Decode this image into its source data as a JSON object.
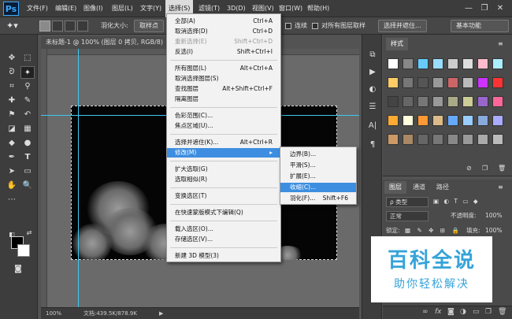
{
  "app": {
    "logo": "Ps"
  },
  "menubar": {
    "items": [
      "文件(F)",
      "编辑(E)",
      "图像(I)",
      "图层(L)",
      "文字(Y)",
      "选择(S)",
      "滤镜(T)",
      "3D(D)",
      "视图(V)",
      "窗口(W)",
      "帮助(H)"
    ]
  },
  "window_controls": {
    "minimize": "—",
    "restore": "❐",
    "close": "✕"
  },
  "options": {
    "feather_label": "羽化大小:",
    "feather_value": "取样点",
    "contiguous_label": "连续",
    "sample_all_label": "对所有图层取样",
    "select_mask_button": "选择并遮住...",
    "workspace_value": "基本功能"
  },
  "document": {
    "tab_title": "未标题-1 @ 100% (图层 0 拷贝, RGB/8) *",
    "zoom": "100%",
    "doc_info": "文档:439.5K/878.9K"
  },
  "select_menu": {
    "items": [
      {
        "label": "全部(A)",
        "shortcut": "Ctrl+A"
      },
      {
        "label": "取消选择(D)",
        "shortcut": "Ctrl+D"
      },
      {
        "label": "重新选择(E)",
        "shortcut": "Shift+Ctrl+D"
      },
      {
        "label": "反选(I)",
        "shortcut": "Shift+Ctrl+I"
      },
      {
        "label": "所有图层(L)",
        "shortcut": "Alt+Ctrl+A"
      },
      {
        "label": "取消选择图层(S)",
        "shortcut": ""
      },
      {
        "label": "查找图层",
        "shortcut": "Alt+Shift+Ctrl+F"
      },
      {
        "label": "隔离图层",
        "shortcut": ""
      },
      {
        "label": "色彩范围(C)...",
        "shortcut": ""
      },
      {
        "label": "焦点区域(U)...",
        "shortcut": ""
      },
      {
        "label": "选择并遮住(K)...",
        "shortcut": "Alt+Ctrl+R"
      },
      {
        "label": "修改(M)",
        "shortcut": "▸"
      },
      {
        "label": "扩大选取(G)",
        "shortcut": ""
      },
      {
        "label": "选取相似(R)",
        "shortcut": ""
      },
      {
        "label": "变换选区(T)",
        "shortcut": ""
      },
      {
        "label": "在快速蒙版模式下编辑(Q)",
        "shortcut": ""
      },
      {
        "label": "载入选区(O)...",
        "shortcut": ""
      },
      {
        "label": "存储选区(V)...",
        "shortcut": ""
      },
      {
        "label": "新建 3D 模型(3)",
        "shortcut": ""
      }
    ]
  },
  "modify_menu": {
    "items": [
      {
        "label": "边界(B)...",
        "shortcut": ""
      },
      {
        "label": "平滑(S)...",
        "shortcut": ""
      },
      {
        "label": "扩展(E)...",
        "shortcut": ""
      },
      {
        "label": "收缩(C)...",
        "shortcut": ""
      },
      {
        "label": "羽化(F)...",
        "shortcut": "Shift+F6"
      }
    ]
  },
  "styles_panel": {
    "tab": "样式"
  },
  "layers_panel": {
    "tabs": [
      "图层",
      "通道",
      "路径"
    ],
    "kind_filter": "ρ 类型",
    "blend_mode": "正常",
    "opacity_label": "不透明度:",
    "opacity_value": "100%",
    "lock_label": "锁定:",
    "fill_label": "填充:",
    "fill_value": "100%"
  },
  "watermark": {
    "title": "百科全说",
    "subtitle": "助你轻松解决"
  },
  "colors": {
    "accent": "#3d8ee0",
    "guide": "#3ec8f0",
    "watermark": "#36a3d8"
  }
}
